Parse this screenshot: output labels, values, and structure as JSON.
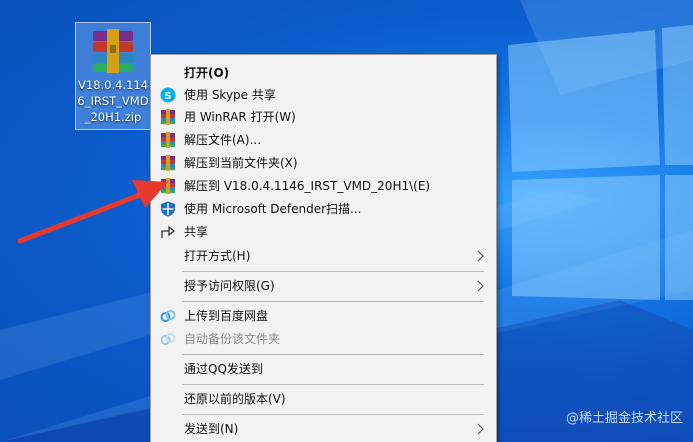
{
  "desktop": {
    "file_icon": {
      "label": "V18.0.4.1146_IRST_VMD_20H1.zip",
      "icon": "winrar-archive-icon"
    }
  },
  "context_menu": {
    "items": [
      {
        "label": "打开(O)",
        "icon": "",
        "bold": true
      },
      {
        "label": "使用 Skype 共享",
        "icon": "skype-icon"
      },
      {
        "label": "用 WinRAR 打开(W)",
        "icon": "winrar-icon"
      },
      {
        "label": "解压文件(A)...",
        "icon": "winrar-icon"
      },
      {
        "label": "解压到当前文件夹(X)",
        "icon": "winrar-icon"
      },
      {
        "label": "解压到 V18.0.4.1146_IRST_VMD_20H1\\(E)",
        "icon": "winrar-icon"
      },
      {
        "label": "使用 Microsoft Defender扫描...",
        "icon": "defender-shield-icon"
      },
      {
        "label": "共享",
        "icon": "share-icon"
      },
      {
        "label": "打开方式(H)",
        "icon": "",
        "submenu": true
      },
      {
        "label": "授予访问权限(G)",
        "icon": "",
        "submenu": true
      },
      {
        "label": "上传到百度网盘",
        "icon": "baidu-netdisk-icon"
      },
      {
        "label": "自动备份该文件夹",
        "icon": "baidu-netdisk-icon",
        "disabled": true
      },
      {
        "label": "通过QQ发送到",
        "icon": ""
      },
      {
        "label": "还原以前的版本(V)",
        "icon": ""
      },
      {
        "label": "发送到(N)",
        "icon": "",
        "submenu": true
      }
    ]
  },
  "watermark": "@稀土掘金技术社区",
  "colors": {
    "arrow": "#e8392f",
    "menu_bg": "#f2f2f2",
    "desktop": "#0b5ccc"
  }
}
